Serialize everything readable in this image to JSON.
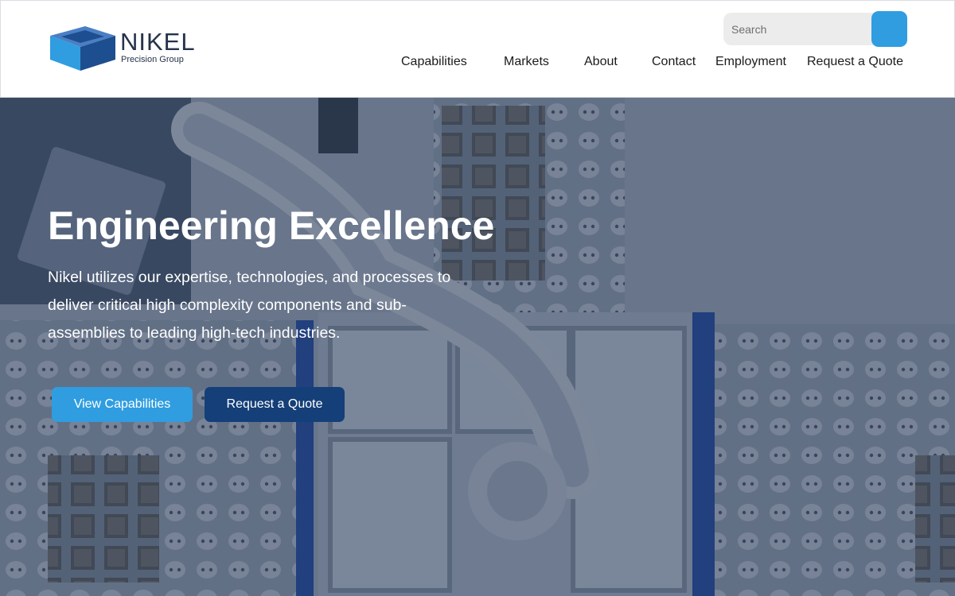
{
  "brand": {
    "name": "NIKEL",
    "tagline": "Precision Group",
    "colors": {
      "cube_top": "#4a7fc4",
      "cube_left": "#2f9de0",
      "cube_right": "#1d4e8f"
    }
  },
  "search": {
    "placeholder": "Search",
    "button_color": "#2f9de0"
  },
  "nav": {
    "items": [
      "Capabilities",
      "Markets",
      "About",
      "Contact",
      "Employment",
      "Request a Quote"
    ]
  },
  "hero": {
    "title_light": "Engineering",
    "title_bold": "Excellence",
    "text": "Nikel utilizes our expertise, technologies, and processes to deliver critical high complexity components and sub-assemblies to leading high-tech industries.",
    "primary_button": "View Capabilities",
    "secondary_button": "Request a Quote",
    "primary_color": "#2f9de0",
    "secondary_color": "#143f78"
  }
}
